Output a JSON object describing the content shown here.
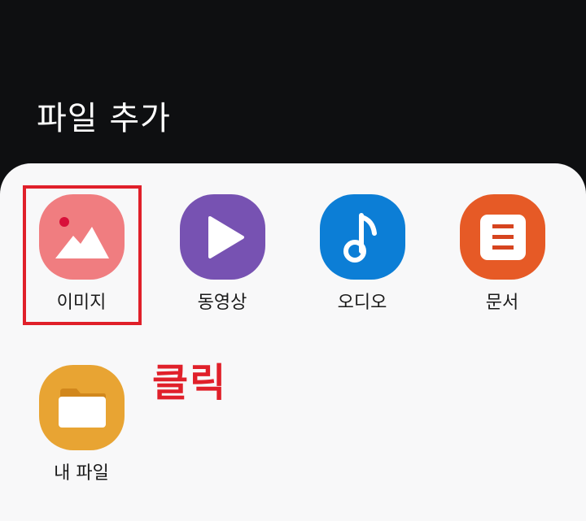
{
  "header": {
    "title": "파일 추가"
  },
  "items": [
    {
      "label": "이미지",
      "icon": "image-icon",
      "color": "#f07d80"
    },
    {
      "label": "동영상",
      "icon": "video-play-icon",
      "color": "#7752b2"
    },
    {
      "label": "오디오",
      "icon": "music-note-icon",
      "color": "#0c7ed6"
    },
    {
      "label": "문서",
      "icon": "document-icon",
      "color": "#e65a26"
    },
    {
      "label": "내 파일",
      "icon": "folder-icon",
      "color": "#e8a433"
    }
  ],
  "annotation": {
    "text": "클릭",
    "color": "#e0202a"
  }
}
